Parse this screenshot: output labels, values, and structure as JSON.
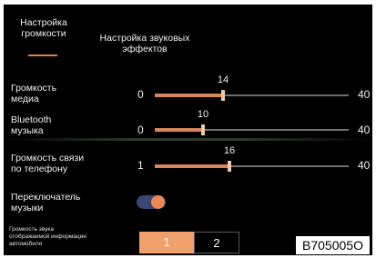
{
  "tabs": [
    {
      "label_line1": "Настройка",
      "label_line2": "громкости",
      "active": true
    },
    {
      "label_line1": "Настройка звуковых",
      "label_line2": "эффектов",
      "active": false
    }
  ],
  "accent_color": "#e0824a",
  "sliders": [
    {
      "label_line1": "Громкость",
      "label_line2": "медиа",
      "min": "0",
      "max": "40",
      "value": "14",
      "level": 14
    },
    {
      "label_line1": "Bluetooth",
      "label_line2": "музыка",
      "min": "0",
      "max": "40",
      "value": "10",
      "level": 10
    },
    {
      "label_line1": "Громкость связи",
      "label_line2": "по телефону",
      "min": "1",
      "max": "40",
      "value": "16",
      "level": 16
    }
  ],
  "music_switch": {
    "label_line1": "Переключатель",
    "label_line2": "музыки",
    "on": true
  },
  "info_volume": {
    "label_line1": "Громкость звука",
    "label_line2": "отображаемой информации",
    "label_line3": "автомобиля",
    "options": [
      "1",
      "2"
    ],
    "selected": "1"
  },
  "image_code": "B705005O"
}
